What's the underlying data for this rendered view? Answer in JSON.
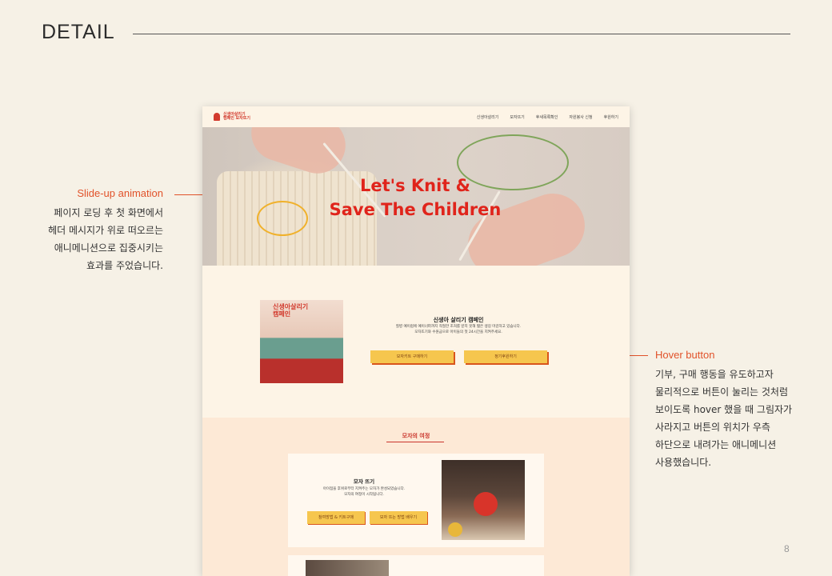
{
  "slide": {
    "title": "DETAIL",
    "page_number": "8"
  },
  "annotations": {
    "left": {
      "title": "Slide-up animation",
      "body": "페이지 로딩 후 첫 화면에서\n헤더 메시지가 위로 떠오르는\n애니메니션으로 집중시키는\n효과를 주었습니다."
    },
    "right": {
      "title": "Hover button",
      "body": "기부, 구매 행동을 유도하고자\n물리적으로 버튼이 눌리는 것처럼\n보이도록 hover 했을 때 그림자가\n사라지고 버튼의 위치가 우측\n하단으로 내려가는 애니메니션\n사용했습니다."
    }
  },
  "mockup": {
    "logo_text": "신생아살리기\n캠페인 모자뜨기",
    "nav_links": [
      "신생아살리기",
      "모자뜨기",
      "후새목록확인",
      "자원봉사 신청",
      "후원하기"
    ],
    "hero": {
      "line1": "Let's Knit &",
      "line2": "Save The Children"
    },
    "campaign": {
      "badge": "신생아살리기\n캠페인",
      "title": "신생아 살리기 캠페인",
      "body": "질병 예이럽에 예이너파까지 적절한 조처를 받지 못해 짧은 생길 마감하고 있습니다.\n모자뜨기와 수원금으로 아이들의 첫 24시간을 지켜주세요.",
      "btn_buy": "모자키트 구매하기",
      "btn_donate": "정기후원하기"
    },
    "journey": {
      "heading": "모자의 여정",
      "card_title": "모자 뜨기",
      "card_body": "아이점을 후위로부터 지켜주는 모자가 완성되었습니다.\n모자의 여정이 시작됩니다.",
      "btn_method": "참여방법 & 키트구매",
      "btn_learn": "모자 뜨는 방법 배우기"
    }
  },
  "colors": {
    "accent": "#e1522a",
    "hero_text": "#e0241b",
    "button": "#f6c64e",
    "button_shadow": "#d9551c",
    "ellipse_yellow": "#f0b12b",
    "ellipse_green": "#7fa55a"
  }
}
